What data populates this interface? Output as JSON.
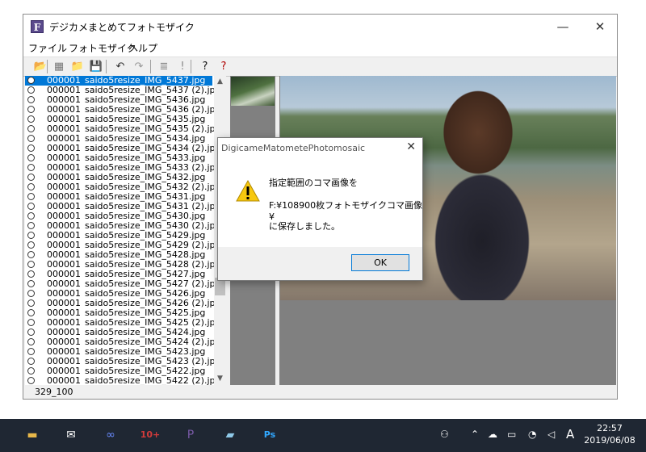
{
  "window": {
    "title": "デジカメまとめてフォトモザイク",
    "controls": {
      "minimize": "—",
      "maximize": "☐",
      "close": "✕"
    }
  },
  "menu": [
    "ファイル",
    "フォトモザイク",
    "ヘルプ"
  ],
  "toolbar": [
    {
      "name": "open-folder-icon",
      "glyph": "📂"
    },
    {
      "name": "picture-icon",
      "glyph": "▦"
    },
    {
      "name": "folder-icon",
      "glyph": "📁"
    },
    {
      "name": "save-icon",
      "glyph": "💾"
    },
    {
      "name": "undo-icon",
      "glyph": "↶"
    },
    {
      "name": "redo-icon",
      "glyph": "↷"
    },
    {
      "name": "list-icon",
      "glyph": "≣"
    },
    {
      "name": "exclamation-icon",
      "glyph": "!"
    },
    {
      "name": "help-icon",
      "glyph": "?"
    },
    {
      "name": "help-context-icon",
      "glyph": "?"
    }
  ],
  "files": [
    {
      "num": "000001",
      "name": "saido5resize_IMG_5437.jpg",
      "selected": true
    },
    {
      "num": "000001",
      "name": "saido5resize_IMG_5437 (2).jpg"
    },
    {
      "num": "000001",
      "name": "saido5resize_IMG_5436.jpg"
    },
    {
      "num": "000001",
      "name": "saido5resize_IMG_5436 (2).jpg"
    },
    {
      "num": "000001",
      "name": "saido5resize_IMG_5435.jpg"
    },
    {
      "num": "000001",
      "name": "saido5resize_IMG_5435 (2).jpg"
    },
    {
      "num": "000001",
      "name": "saido5resize_IMG_5434.jpg"
    },
    {
      "num": "000001",
      "name": "saido5resize_IMG_5434 (2).jpg"
    },
    {
      "num": "000001",
      "name": "saido5resize_IMG_5433.jpg"
    },
    {
      "num": "000001",
      "name": "saido5resize_IMG_5433 (2).jpg"
    },
    {
      "num": "000001",
      "name": "saido5resize_IMG_5432.jpg"
    },
    {
      "num": "000001",
      "name": "saido5resize_IMG_5432 (2).jpg"
    },
    {
      "num": "000001",
      "name": "saido5resize_IMG_5431.jpg"
    },
    {
      "num": "000001",
      "name": "saido5resize_IMG_5431 (2).jpg"
    },
    {
      "num": "000001",
      "name": "saido5resize_IMG_5430.jpg"
    },
    {
      "num": "000001",
      "name": "saido5resize_IMG_5430 (2).jpg"
    },
    {
      "num": "000001",
      "name": "saido5resize_IMG_5429.jpg"
    },
    {
      "num": "000001",
      "name": "saido5resize_IMG_5429 (2).jpg"
    },
    {
      "num": "000001",
      "name": "saido5resize_IMG_5428.jpg"
    },
    {
      "num": "000001",
      "name": "saido5resize_IMG_5428 (2).jpg"
    },
    {
      "num": "000001",
      "name": "saido5resize_IMG_5427.jpg"
    },
    {
      "num": "000001",
      "name": "saido5resize_IMG_5427 (2).jpg"
    },
    {
      "num": "000001",
      "name": "saido5resize_IMG_5426.jpg"
    },
    {
      "num": "000001",
      "name": "saido5resize_IMG_5426 (2).jpg"
    },
    {
      "num": "000001",
      "name": "saido5resize_IMG_5425.jpg"
    },
    {
      "num": "000001",
      "name": "saido5resize_IMG_5425 (2).jpg"
    },
    {
      "num": "000001",
      "name": "saido5resize_IMG_5424.jpg"
    },
    {
      "num": "000001",
      "name": "saido5resize_IMG_5424 (2).jpg"
    },
    {
      "num": "000001",
      "name": "saido5resize_IMG_5423.jpg"
    },
    {
      "num": "000001",
      "name": "saido5resize_IMG_5423 (2).jpg"
    },
    {
      "num": "000001",
      "name": "saido5resize_IMG_5422.jpg"
    },
    {
      "num": "000001",
      "name": "saido5resize_IMG_5422 (2).jpg"
    }
  ],
  "status": "329_100",
  "dialog": {
    "title": "DigicameMatometePhotomosaic",
    "lines": [
      "指定範囲のコマ画像を",
      "F:¥108900枚フォトモザイクコマ画像¥",
      "に保存しました。"
    ],
    "ok_label": "OK"
  },
  "taskbar": {
    "apps": [
      {
        "name": "file-explorer-icon",
        "glyph": "▬",
        "color": "#e8b84a"
      },
      {
        "name": "mail-icon",
        "glyph": "✉",
        "color": "#ffffff"
      },
      {
        "name": "infinity-icon",
        "glyph": "∞",
        "color": "#6a8cff"
      },
      {
        "name": "calendar-badge-icon",
        "glyph": "10+",
        "color": "#d23b3b"
      },
      {
        "name": "photomosaic-app-icon",
        "glyph": "P",
        "color": "#7a5aa8"
      },
      {
        "name": "notebook-icon",
        "glyph": "▰",
        "color": "#8fc9e8"
      },
      {
        "name": "photoshop-icon",
        "glyph": "Ps",
        "color": "#31a8ff"
      }
    ],
    "time": "22:57",
    "date": "2019/06/08",
    "ime": "A"
  }
}
